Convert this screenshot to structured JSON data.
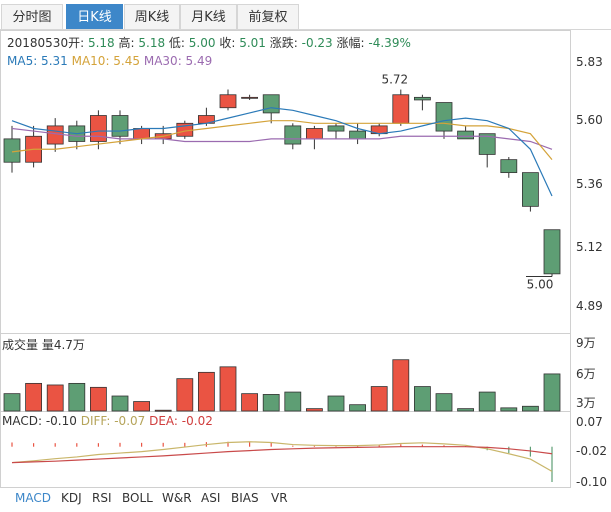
{
  "tabs": [
    {
      "label": "分时图",
      "active": false
    },
    {
      "label": "日K线",
      "active": true
    },
    {
      "label": "周K线",
      "active": false
    },
    {
      "label": "月K线",
      "active": false
    },
    {
      "label": "前复权",
      "active": false
    }
  ],
  "info": {
    "date": "20180530",
    "open_label": "开:",
    "open": "5.18",
    "high_label": "高:",
    "high": "5.18",
    "low_label": "低:",
    "low": "5.00",
    "close_label": "收:",
    "close": "5.01",
    "change_label": "涨跌:",
    "change": "-0.23",
    "pct_label": "涨幅:",
    "pct": "-4.39%"
  },
  "ma_labels": {
    "ma5": "MA5: 5.31",
    "ma10": "MA10: 5.45",
    "ma30": "MA30: 5.49"
  },
  "price_axis": [
    "5.83",
    "5.60",
    "5.36",
    "5.12",
    "4.89"
  ],
  "annotations": {
    "high_mark": "5.72",
    "low_mark": "5.00"
  },
  "volume": {
    "label": "成交量 量4.7万",
    "axis": [
      "9万",
      "6万",
      "3万"
    ]
  },
  "macd": {
    "macd_label": "MACD: -0.10",
    "diff_label": "DIFF: -0.07",
    "dea_label": "DEA: -0.02",
    "axis": [
      "0.07",
      "-0.02",
      "-0.10"
    ]
  },
  "bottom_tabs": [
    {
      "label": "MACD",
      "active": true
    },
    {
      "label": "KDJ",
      "active": false
    },
    {
      "label": "RSI",
      "active": false
    },
    {
      "label": "BOLL",
      "active": false
    },
    {
      "label": "W&R",
      "active": false
    },
    {
      "label": "ASI",
      "active": false
    },
    {
      "label": "BIAS",
      "active": false
    },
    {
      "label": "VR",
      "active": false
    }
  ],
  "colors": {
    "up": "#ea5443",
    "down": "#5e9e74",
    "ma5": "#2b7ab8",
    "ma10": "#d4a33a",
    "ma30": "#9b6bb0",
    "accent": "#3d87c9"
  },
  "chart_data": {
    "type": "candlestick",
    "ylim": [
      4.89,
      5.83
    ],
    "candles": [
      {
        "o": 5.53,
        "h": 5.58,
        "l": 5.4,
        "c": 5.44
      },
      {
        "o": 5.44,
        "h": 5.58,
        "l": 5.42,
        "c": 5.54
      },
      {
        "o": 5.51,
        "h": 5.61,
        "l": 5.48,
        "c": 5.58
      },
      {
        "o": 5.58,
        "h": 5.6,
        "l": 5.49,
        "c": 5.52
      },
      {
        "o": 5.52,
        "h": 5.64,
        "l": 5.49,
        "c": 5.62
      },
      {
        "o": 5.62,
        "h": 5.64,
        "l": 5.51,
        "c": 5.54
      },
      {
        "o": 5.53,
        "h": 5.58,
        "l": 5.51,
        "c": 5.57
      },
      {
        "o": 5.53,
        "h": 5.58,
        "l": 5.51,
        "c": 5.55
      },
      {
        "o": 5.54,
        "h": 5.6,
        "l": 5.53,
        "c": 5.59
      },
      {
        "o": 5.59,
        "h": 5.65,
        "l": 5.58,
        "c": 5.62
      },
      {
        "o": 5.65,
        "h": 5.72,
        "l": 5.64,
        "c": 5.7
      },
      {
        "o": 5.69,
        "h": 5.7,
        "l": 5.68,
        "c": 5.69
      },
      {
        "o": 5.7,
        "h": 5.7,
        "l": 5.59,
        "c": 5.63
      },
      {
        "o": 5.58,
        "h": 5.59,
        "l": 5.49,
        "c": 5.51
      },
      {
        "o": 5.53,
        "h": 5.58,
        "l": 5.49,
        "c": 5.57
      },
      {
        "o": 5.58,
        "h": 5.59,
        "l": 5.53,
        "c": 5.56
      },
      {
        "o": 5.56,
        "h": 5.59,
        "l": 5.51,
        "c": 5.53
      },
      {
        "o": 5.55,
        "h": 5.59,
        "l": 5.54,
        "c": 5.58
      },
      {
        "o": 5.59,
        "h": 5.72,
        "l": 5.58,
        "c": 5.7
      },
      {
        "o": 5.69,
        "h": 5.7,
        "l": 5.64,
        "c": 5.68
      },
      {
        "o": 5.67,
        "h": 5.67,
        "l": 5.53,
        "c": 5.56
      },
      {
        "o": 5.56,
        "h": 5.58,
        "l": 5.53,
        "c": 5.53
      },
      {
        "o": 5.55,
        "h": 5.55,
        "l": 5.42,
        "c": 5.47
      },
      {
        "o": 5.45,
        "h": 5.46,
        "l": 5.38,
        "c": 5.4
      },
      {
        "o": 5.4,
        "h": 5.4,
        "l": 5.25,
        "c": 5.27
      },
      {
        "o": 5.18,
        "h": 5.18,
        "l": 5.0,
        "c": 5.01
      }
    ],
    "ma5": [
      5.6,
      5.57,
      5.56,
      5.55,
      5.56,
      5.56,
      5.57,
      5.57,
      5.58,
      5.59,
      5.61,
      5.63,
      5.65,
      5.64,
      5.62,
      5.6,
      5.57,
      5.55,
      5.56,
      5.58,
      5.6,
      5.61,
      5.6,
      5.57,
      5.49,
      5.31
    ],
    "ma10": [
      5.48,
      5.49,
      5.49,
      5.5,
      5.51,
      5.52,
      5.53,
      5.54,
      5.56,
      5.57,
      5.58,
      5.59,
      5.6,
      5.6,
      5.59,
      5.59,
      5.59,
      5.59,
      5.59,
      5.59,
      5.59,
      5.58,
      5.58,
      5.57,
      5.55,
      5.45
    ],
    "ma30": [
      5.57,
      5.56,
      5.55,
      5.54,
      5.54,
      5.53,
      5.53,
      5.53,
      5.52,
      5.52,
      5.52,
      5.52,
      5.53,
      5.53,
      5.53,
      5.53,
      5.53,
      5.53,
      5.54,
      5.54,
      5.54,
      5.54,
      5.54,
      5.53,
      5.52,
      5.49
    ],
    "volume_ylim": [
      0,
      9
    ],
    "volumes": [
      2.2,
      3.5,
      3.3,
      3.5,
      3.0,
      1.9,
      1.2,
      0.1,
      4.1,
      4.9,
      5.6,
      2.2,
      2.1,
      2.4,
      0.3,
      1.9,
      0.8,
      3.1,
      6.5,
      3.1,
      2.2,
      0.3,
      2.4,
      0.4,
      0.6,
      4.7
    ],
    "macd_ylim": [
      -0.1,
      0.07
    ],
    "macd": [
      0.012,
      0.01,
      0.01,
      0.01,
      0.01,
      0.011,
      0.011,
      0.011,
      0.011,
      0.013,
      0.014,
      0.013,
      0.012,
      0.003,
      0.003,
      0.003,
      0.003,
      0.004,
      0.007,
      0.006,
      0.004,
      0.002,
      -0.01,
      -0.018,
      -0.028,
      -0.1
    ],
    "diff": [
      -0.045,
      -0.04,
      -0.034,
      -0.029,
      -0.022,
      -0.018,
      -0.014,
      -0.008,
      -0.001,
      0.006,
      0.012,
      0.014,
      0.012,
      0.006,
      0.004,
      0.003,
      0.003,
      0.005,
      0.009,
      0.011,
      0.008,
      0.004,
      -0.006,
      -0.02,
      -0.035,
      -0.07
    ],
    "dea": [
      -0.045,
      -0.043,
      -0.041,
      -0.038,
      -0.035,
      -0.032,
      -0.029,
      -0.026,
      -0.022,
      -0.018,
      -0.014,
      -0.011,
      -0.008,
      -0.006,
      -0.004,
      -0.003,
      -0.002,
      -0.001,
      0.0,
      0.0,
      0.0,
      0.0,
      -0.002,
      -0.006,
      -0.012,
      -0.02
    ]
  }
}
